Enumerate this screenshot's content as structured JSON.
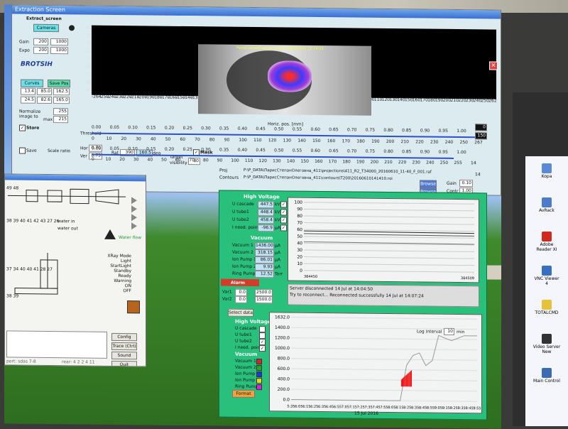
{
  "app": {
    "title": "Extraction Screen",
    "subtitle": "Extract_screen",
    "cameras_button": "Cameras",
    "logo_text": "BROTSIH"
  },
  "left_controls": {
    "gain_label": "Gain",
    "gain_values": [
      "200",
      "1000"
    ],
    "expo_label": "Expo",
    "expo_values": [
      "200",
      "1000"
    ],
    "curves_button": "Curves",
    "save_pos_button": "Save Pos",
    "fields": [
      "13.4",
      "85.0",
      "162.5",
      "24.5",
      "82.6",
      "165.0"
    ],
    "normalize_label": "Normalize image to",
    "max_label": "max",
    "normalize_values": [
      "255",
      "215"
    ],
    "store_label": "Store",
    "threshold_label": "Threshold",
    "save_label": "Save",
    "scale_ratio_label": "Scale ratio",
    "hor_label": "Hor",
    "hor_value": "0.70",
    "ver_label": "Ver",
    "ver_value": "0.75",
    "rat_label": "Rat",
    "rat_values": [
      "390",
      "160.5"
    ],
    "deg_label": "deg",
    "target_label": "Target",
    "visibility_label": "visibility",
    "visibility_value": "80",
    "mask_label": "Mask"
  },
  "image_view": {
    "overlay_text": "ParisСтепанОлеговна_411 15/07/2016 11:14:52",
    "horiz_label": "Horiz. pos. [mm]",
    "top_ruler": [
      "-264",
      "-250",
      "-240",
      "-230",
      "-220",
      "-210",
      "-200",
      "-190",
      "-180",
      "-170",
      "-160",
      "-150",
      "-140",
      "-130",
      "-120",
      "-110",
      "-100",
      "-90",
      "-80",
      "-70",
      "-60",
      "-50",
      "-40",
      "-30",
      "-20",
      "-10",
      "0",
      "10",
      "20",
      "30",
      "40",
      "50",
      "60",
      "70",
      "80",
      "90",
      "100",
      "110",
      "120",
      "130",
      "140",
      "150",
      "160",
      "170",
      "180",
      "190",
      "200",
      "210",
      "220",
      "230",
      "240",
      "250",
      "262"
    ],
    "left_ruler": [
      "40",
      "30",
      "20",
      "10",
      "0",
      "-10",
      "-20",
      "-30",
      "-40"
    ],
    "right_values": [
      "0",
      "150"
    ]
  },
  "threshold_ruler": {
    "row1": [
      "0.00",
      "0.05",
      "0.10",
      "0.15",
      "0.20",
      "0.25",
      "0.30",
      "0.35",
      "0.40",
      "0.45",
      "0.50",
      "0.55",
      "0.60",
      "0.65",
      "0.70",
      "0.75",
      "0.80",
      "0.85",
      "0.90",
      "0.95",
      "1.00"
    ],
    "row2": [
      "0",
      "10",
      "20",
      "30",
      "40",
      "50",
      "60",
      "70",
      "80",
      "90",
      "100",
      "110",
      "120",
      "130",
      "140",
      "150",
      "160",
      "170",
      "180",
      "190",
      "200",
      "210",
      "220",
      "230",
      "240",
      "250",
      "267"
    ],
    "row3": [
      "0.00",
      "0.05",
      "0.10",
      "0.15",
      "0.20",
      "0.25",
      "0.30",
      "0.35",
      "0.40",
      "0.45",
      "0.50",
      "0.55",
      "0.60",
      "0.65",
      "0.70",
      "0.75",
      "0.80",
      "0.85",
      "0.90",
      "0.95",
      "1.00"
    ],
    "row4": [
      "0",
      "10",
      "20",
      "30",
      "40",
      "50",
      "60",
      "70",
      "80",
      "90",
      "100",
      "110",
      "120",
      "130",
      "140",
      "150",
      "160",
      "170",
      "180",
      "190",
      "200",
      "210",
      "220",
      "230",
      "240",
      "250",
      "255"
    ],
    "end_values": [
      "14",
      "14"
    ]
  },
  "files": {
    "proj_label": "Proj",
    "contours_label": "Contours",
    "proj_path": "P:\\P_DATA\\ПарисСтепанОлеговна_411\\projections\\411_R2_T34000_20160610_11-40_F_001.raf",
    "contours_path": "P:\\P_DATA\\ПарисСтепанОлеговна_411\\contours\\T200\\20160610141410.roi",
    "browse1": "Browse",
    "browse2": "Browse",
    "gain_label": "Gain",
    "gain_value": "0.10",
    "contr_label": "Contr",
    "contr_value": "1.00"
  },
  "panel": {
    "hv_header": "High Voltage",
    "hv_rows": [
      {
        "label": "U cascade",
        "value": "447.5",
        "unit": "kV"
      },
      {
        "label": "U tube1",
        "value": "448.4",
        "unit": "kV"
      },
      {
        "label": "U tube2",
        "value": "458.4",
        "unit": "kV"
      },
      {
        "label": "I need. point",
        "value": "-96.9",
        "unit": "µA"
      }
    ],
    "vacuum_header": "Vacuum",
    "vac_rows": [
      {
        "label": "Vacuum 1",
        "value": "1436.00",
        "unit": "µA"
      },
      {
        "label": "Vacuum 2",
        "value": "318.15",
        "unit": "µA"
      },
      {
        "label": "Ion Pump 1",
        "value": "86.01",
        "unit": "µA"
      },
      {
        "label": "Ion Pump 2",
        "value": "9.93",
        "unit": "µA"
      },
      {
        "label": "Ring Pump",
        "value": "12.52",
        "unit": "Torr"
      }
    ],
    "alarm_label": "Alarm",
    "vari_rows": [
      {
        "label": "Var1",
        "values": [
          "0.0",
          "2500.0"
        ]
      },
      {
        "label": "Var2",
        "values": [
          "0.0",
          "1500.0"
        ]
      }
    ],
    "messages": [
      "Server disconnected 14 Jul at 14:04:50",
      "Try to reconnect...  Reconnected successfully 14 Jul at 14:07:24"
    ],
    "select_data": "Select data",
    "log_interval_label": "Log interval",
    "log_interval_value": "10",
    "log_interval_unit": "min",
    "chart_hv_header": "High Voltage",
    "chart_hv_items": [
      "U cascade",
      "U tube1",
      "U tube2",
      "I need. point"
    ],
    "chart_vac_header": "Vacuum",
    "chart_vac_items": [
      "Vacuum 1",
      "Vacuum 2",
      "Ion Pump 1",
      "Ion Pump 2",
      "Ring Pump"
    ],
    "format_button": "Format",
    "date_label": "15 Jul 2016"
  },
  "top_chart": {
    "y_ticks": [
      "100",
      "90",
      "80",
      "70",
      "60",
      "50",
      "40",
      "30",
      "20",
      "10",
      "0"
    ],
    "corner_left": "384450",
    "corner_right": "384509"
  },
  "bottom_chart": {
    "y_ticks": [
      "1632.0",
      "1400.0",
      "1200.0",
      "1000.0",
      "800.0",
      "600.0",
      "400.0",
      "200.0",
      "0.0"
    ],
    "x_ticks": [
      "5:35",
      "6:05",
      "6:15",
      "6:25",
      "6:35",
      "6:45",
      "6:55",
      "7:05",
      "7:15",
      "7:25",
      "7:35",
      "7:45",
      "7:55",
      "8:05",
      "8:15",
      "8:25",
      "8:35",
      "8:45",
      "8:55",
      "9:05",
      "9:15",
      "9:25",
      "9:35",
      "9:45",
      "9:55"
    ],
    "series": [
      {
        "name": "U tube1",
        "values": [
          0,
          0,
          0,
          0,
          0,
          0,
          0,
          0,
          0,
          0,
          0,
          0,
          0,
          0,
          0,
          0,
          0,
          0,
          700,
          900,
          950,
          700,
          800,
          1300,
          1250,
          1200,
          1250,
          1300,
          1300,
          1300
        ]
      }
    ]
  },
  "dose_window": {
    "water_in": "water in",
    "water_out": "water out",
    "water_flow": "Water flow",
    "modes": [
      "XRay Mode",
      "Light",
      "StartLight",
      "Standby",
      "Ready",
      "Warning",
      "ON",
      "OFF"
    ],
    "buttons": [
      "Config",
      "Trace (Ctrl)",
      "Sound",
      "Quit"
    ],
    "status_left": "port: sdas 7-8",
    "status_right": "rear: 4 2 2 4 11",
    "numbers_row": "38 39 40 41 42 43 27 26",
    "numbers_row2": "37 34 40 40 41 28 27",
    "numbers_row3": "38 39",
    "numbers_row4": "49 48"
  },
  "desktop_icons": [
    {
      "label": "Kopa",
      "color": "#5a8ad6"
    },
    {
      "label": "AvRack",
      "color": "#4b7bc9"
    },
    {
      "label": "Adobe Reader XI",
      "color": "#d02a1e"
    },
    {
      "label": "VNC Viewer 4",
      "color": "#3a6fc0"
    },
    {
      "label": "TOTALCMD",
      "color": "#e6c13a"
    },
    {
      "label": "Video Server New",
      "color": "#333333"
    },
    {
      "label": "Main Control",
      "color": "#3d6bb3"
    }
  ],
  "second_screen_partial_label": "Ko"
}
